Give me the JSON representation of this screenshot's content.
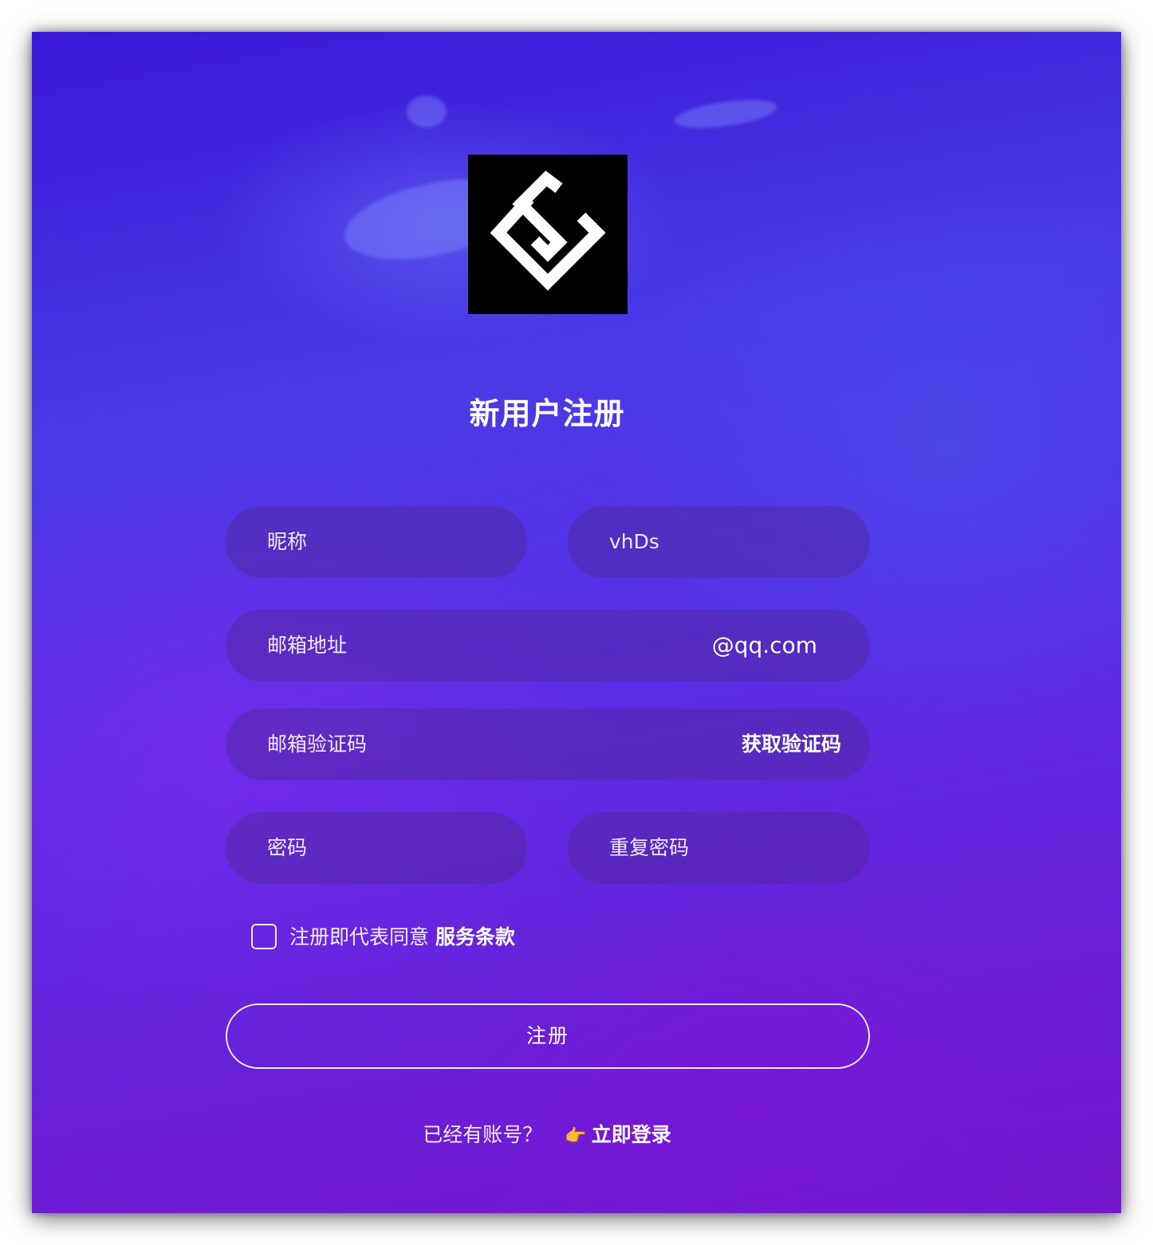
{
  "page": {
    "title": "新用户注册"
  },
  "form": {
    "nickname_placeholder": "昵称",
    "username_value": "vhDs",
    "email_placeholder": "邮箱地址",
    "email_suffix": "@qq.com",
    "code_placeholder": "邮箱验证码",
    "get_code_label": "获取验证码",
    "password_placeholder": "密码",
    "confirm_password_placeholder": "重复密码",
    "agree_text": "注册即代表同意",
    "terms_link": "服务条款",
    "submit_label": "注册"
  },
  "footer": {
    "prompt": "已经有账号？",
    "hand_icon": "👉",
    "login_link": "立即登录"
  },
  "colors": {
    "background_top": "#3a18d8",
    "background_bottom": "#7316cc",
    "logo_bg": "#000000",
    "text": "#ffffff"
  }
}
